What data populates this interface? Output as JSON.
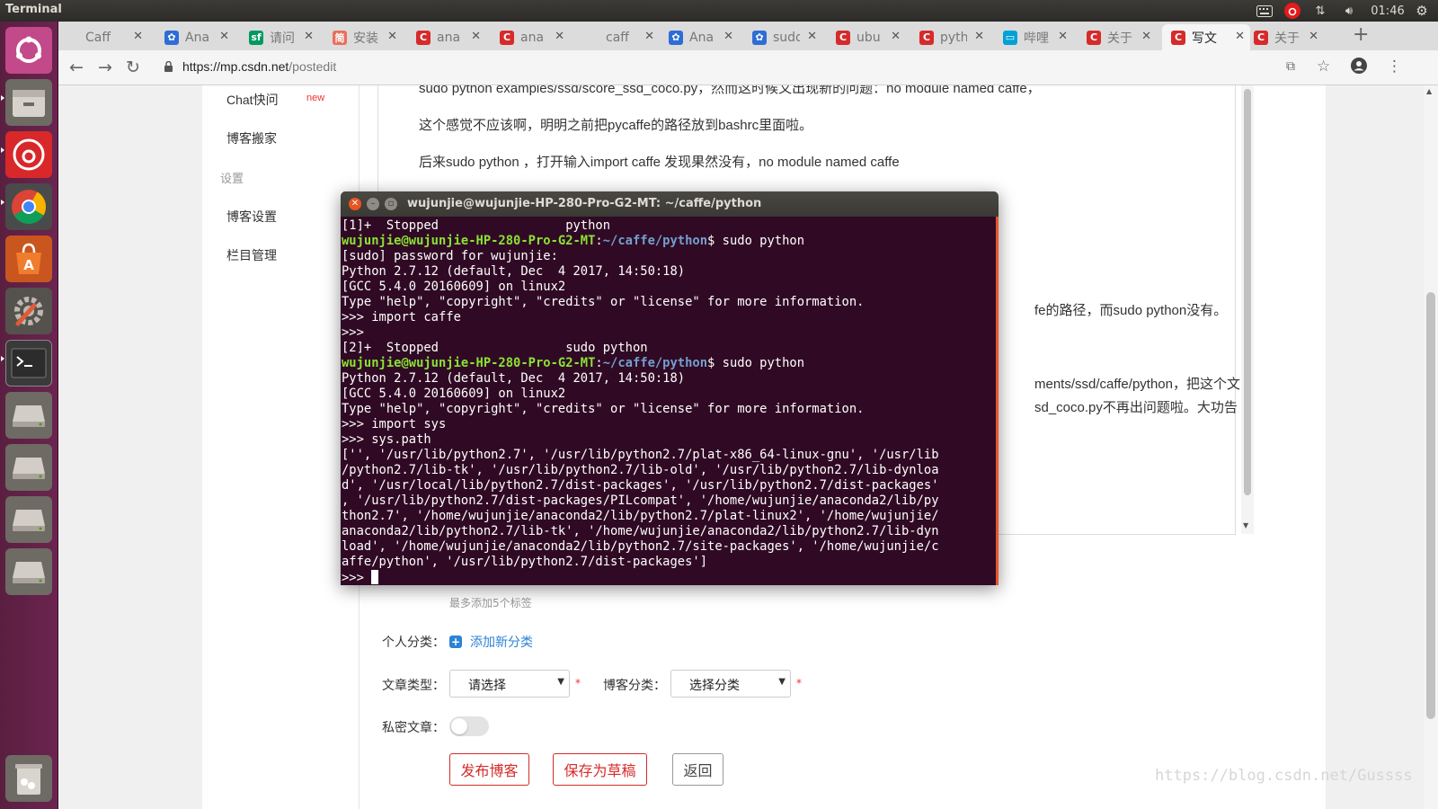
{
  "panel": {
    "title": "Terminal",
    "time": "01:46"
  },
  "launcher": [
    {
      "name": "ubuntu-dash-icon"
    },
    {
      "name": "file-manager-icon"
    },
    {
      "name": "netease-music-icon"
    },
    {
      "name": "chrome-icon"
    },
    {
      "name": "software-center-icon"
    },
    {
      "name": "system-settings-icon"
    },
    {
      "name": "terminal-icon"
    },
    {
      "name": "drive-icon"
    },
    {
      "name": "drive-icon"
    },
    {
      "name": "drive-icon"
    },
    {
      "name": "drive-icon"
    },
    {
      "name": "trash-icon"
    }
  ],
  "tabs": [
    {
      "title": "Caff",
      "favicon": "",
      "active": false
    },
    {
      "title": "Ana",
      "favicon": "baidu",
      "active": false
    },
    {
      "title": "请问",
      "favicon": "sf",
      "active": false
    },
    {
      "title": "安装",
      "favicon": "jianshu",
      "active": false
    },
    {
      "title": "ana",
      "favicon": "csdn",
      "active": false
    },
    {
      "title": "ana",
      "favicon": "csdn",
      "active": false
    },
    {
      "title": "caff",
      "favicon": "",
      "active": false
    },
    {
      "title": "Ana",
      "favicon": "baidu",
      "active": false
    },
    {
      "title": "sudo",
      "favicon": "baidu",
      "active": false
    },
    {
      "title": "ubu",
      "favicon": "csdn",
      "active": false
    },
    {
      "title": "pyth",
      "favicon": "csdn",
      "active": false
    },
    {
      "title": "哔哩",
      "favicon": "bilibili",
      "active": false
    },
    {
      "title": "关于",
      "favicon": "csdn",
      "active": false
    },
    {
      "title": "写文",
      "favicon": "csdn",
      "active": true
    },
    {
      "title": "关于",
      "favicon": "csdn",
      "active": false
    }
  ],
  "omnibox": {
    "url_domain": "https://mp.csdn.net",
    "url_path": "/postedit"
  },
  "sidebar": {
    "chat": "Chat快问",
    "chat_badge": "new",
    "blog_move": "博客搬家",
    "settings_head": "设置",
    "blog_settings": "博客设置",
    "column_manage": "栏目管理"
  },
  "editor": {
    "para1": "sudo python examples/ssd/score_ssd_coco.py，然而这时候又出现新的问题：no module named caffe，",
    "para2": "这个感觉不应该啊，明明之前把pycaffe的路径放到bashrc里面啦。",
    "para3": "后来sudo python ，打开输入import caffe 发现果然没有，no module named caffe",
    "para4_tail": "fe的路径，而sudo python没有。",
    "para5_tail": "ments/ssd/caffe/python，把这个文",
    "para6_tail": "sd_coco.py不再出问题啦。大功告"
  },
  "form": {
    "tag_hint": "最多添加5个标签",
    "personal_category_label": "个人分类：",
    "add_category": "添加新分类",
    "article_type_label": "文章类型：",
    "article_type_value": "请选择",
    "blog_category_label": "博客分类：",
    "blog_category_value": "选择分类",
    "private_label": "私密文章：",
    "required_mark": "*",
    "publish_button": "发布博客",
    "save_draft_button": "保存为草稿",
    "back_button": "返回"
  },
  "watermark": "https://blog.csdn.net/Gussss",
  "terminal": {
    "title": "wujunjie@wujunjie-HP-280-Pro-G2-MT: ~/caffe/python",
    "user_host": "wujunjie@wujunjie-HP-280-Pro-G2-MT",
    "cwd": "~/caffe/python",
    "lines": [
      "[1]+  Stopped                 python",
      {
        "prompt": true,
        "cmd": "$ sudo python"
      },
      "[sudo] password for wujunjie:",
      "Python 2.7.12 (default, Dec  4 2017, 14:50:18)",
      "[GCC 5.4.0 20160609] on linux2",
      "Type \"help\", \"copyright\", \"credits\" or \"license\" for more information.",
      ">>> import caffe",
      ">>>",
      "[2]+  Stopped                 sudo python",
      {
        "prompt": true,
        "cmd": "$ sudo python"
      },
      "Python 2.7.12 (default, Dec  4 2017, 14:50:18)",
      "[GCC 5.4.0 20160609] on linux2",
      "Type \"help\", \"copyright\", \"credits\" or \"license\" for more information.",
      ">>> import sys",
      ">>> sys.path",
      "['', '/usr/lib/python2.7', '/usr/lib/python2.7/plat-x86_64-linux-gnu', '/usr/lib",
      "/python2.7/lib-tk', '/usr/lib/python2.7/lib-old', '/usr/lib/python2.7/lib-dynloa",
      "d', '/usr/local/lib/python2.7/dist-packages', '/usr/lib/python2.7/dist-packages'",
      ", '/usr/lib/python2.7/dist-packages/PILcompat', '/home/wujunjie/anaconda2/lib/py",
      "thon2.7', '/home/wujunjie/anaconda2/lib/python2.7/plat-linux2', '/home/wujunjie/",
      "anaconda2/lib/python2.7/lib-tk', '/home/wujunjie/anaconda2/lib/python2.7/lib-dyn",
      "load', '/home/wujunjie/anaconda2/lib/python2.7/site-packages', '/home/wujunjie/c",
      "affe/python', '/usr/lib/python2.7/dist-packages']",
      {
        "cursor": true,
        "text": ">>> "
      }
    ]
  },
  "colors": {
    "terminal_bg": "#300a24",
    "prompt_user": "#8ae234",
    "prompt_path": "#729fcf",
    "csdn_red": "#d62b2b",
    "link_blue": "#2c83d6"
  }
}
